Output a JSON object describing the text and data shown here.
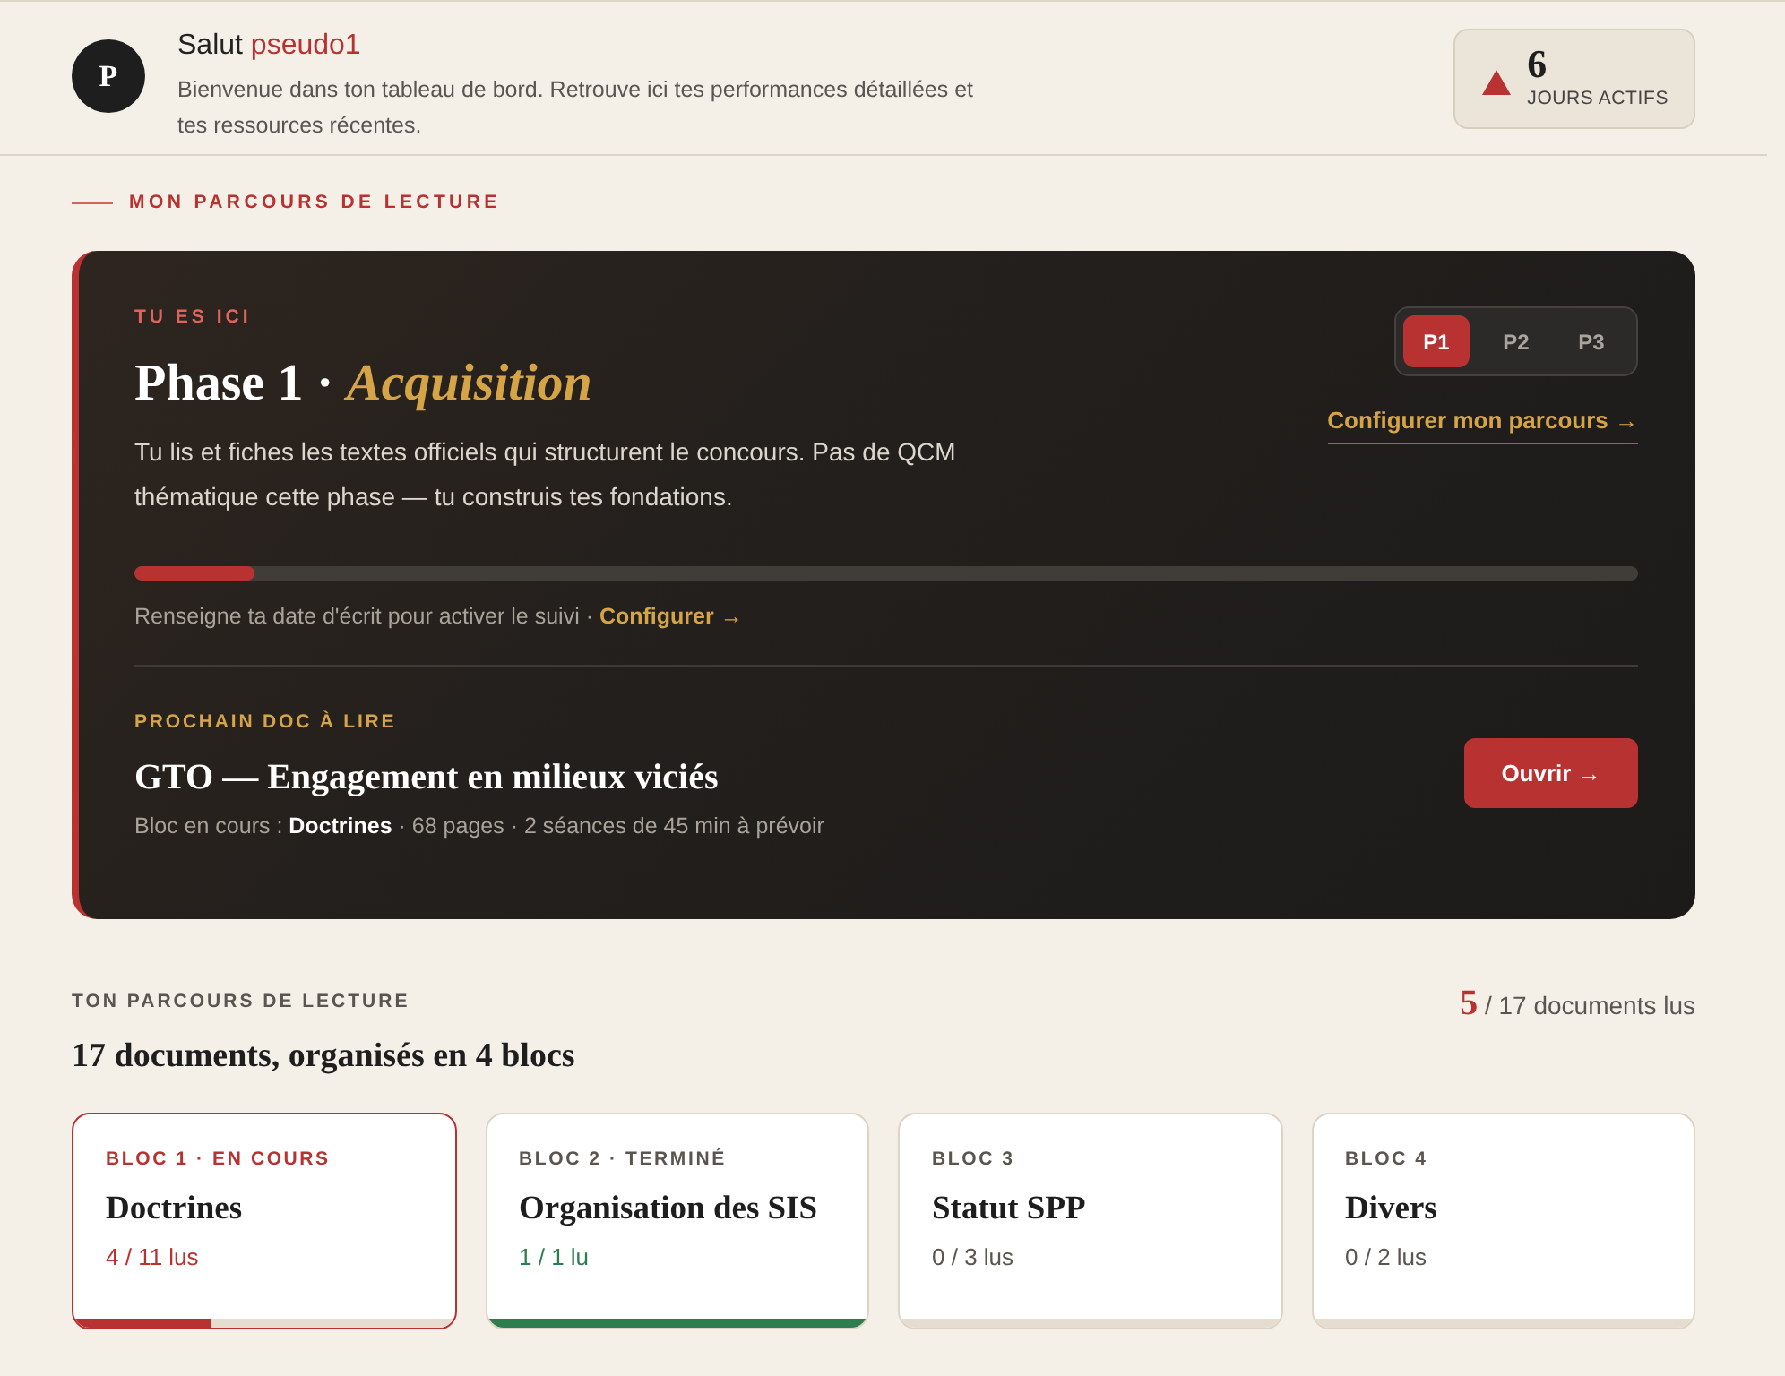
{
  "header": {
    "avatar_initial": "P",
    "greeting": "Salut",
    "username": "pseudo1",
    "description": "Bienvenue dans ton tableau de bord. Retrouve ici tes performances détaillées et tes ressources récentes."
  },
  "streak": {
    "value": "6",
    "label": "JOURS ACTIFS"
  },
  "section_label": "MON PARCOURS DE LECTURE",
  "current_phase": {
    "eyebrow": "TU ES ICI",
    "title": "Phase 1 · *Acquisition*",
    "description": "Tu lis et fiches les textes officiels qui structurent le concours. Pas de QCM thématique cette phase — tu construis tes fondations.",
    "phases": [
      {
        "label": "P1",
        "selected": true
      },
      {
        "label": "P2",
        "selected": false
      },
      {
        "label": "P3",
        "selected": false
      }
    ],
    "configure_link": "Configurer mon parcours →",
    "progress": {
      "level": 0.08
    },
    "hint": "Renseigne ta date d'écrit pour activer le suivi ·",
    "hint_link": "Configurer →"
  },
  "next_doc": {
    "eyebrow": "PROCHAIN DOC À LIRE",
    "title": "GTO — Engagement en milieux viciés",
    "meta": "Bloc en cours : **Doctrines** · 68 pages · 2 séances de 45 min à prévoir",
    "button": "Ouvrir →"
  },
  "reading_path": {
    "eyebrow": "TON PARCOURS DE LECTURE",
    "documents_read": "**5** / 17 documents lus",
    "title": "17 documents, organisés en 4 blocs",
    "blocks": [
      {
        "label": "BLOC 1 · EN COURS",
        "name": "Doctrines",
        "count": "4 / 11 lus",
        "current": true,
        "completed": false,
        "level": 0.36
      },
      {
        "label": "BLOC 2 · TERMINÉ",
        "name": "Organisation des SIS",
        "count": "1 / 1 lu",
        "current": false,
        "completed": true,
        "level": 1
      },
      {
        "label": "BLOC 3",
        "name": "Statut SPP",
        "count": "0 / 3 lus",
        "current": false,
        "completed": false
      },
      {
        "label": "BLOC 4",
        "name": "Divers",
        "count": "0 / 2 lus",
        "current": false,
        "completed": false
      }
    ]
  }
}
